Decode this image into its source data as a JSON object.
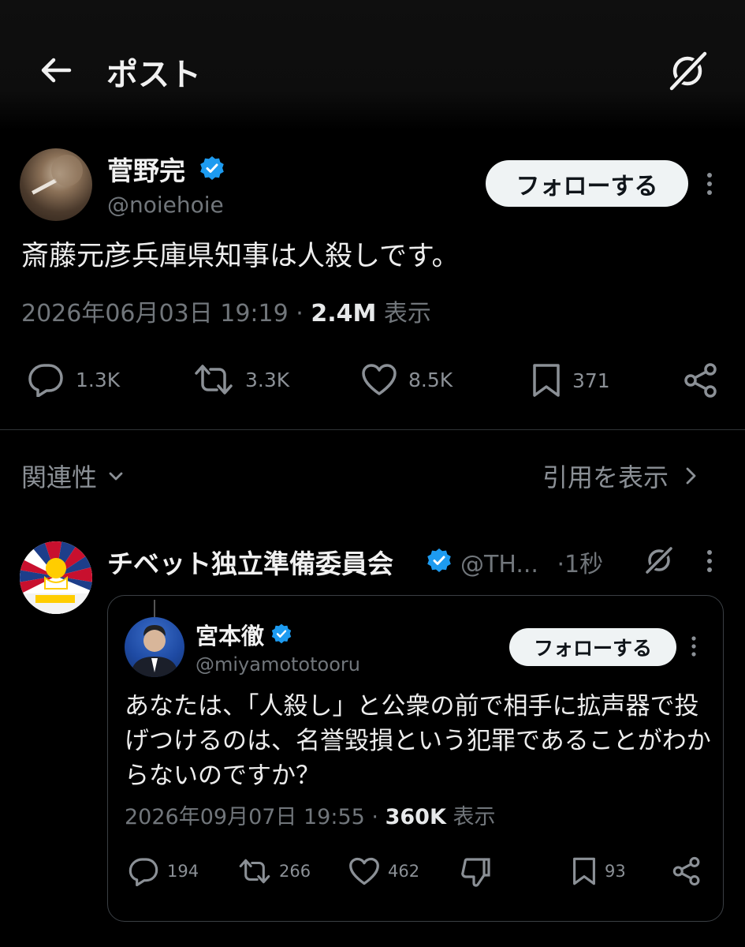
{
  "header": {
    "title": "ポスト"
  },
  "post": {
    "author": "菅野完",
    "handle": "@noiehoie",
    "follow_label": "フォローする",
    "text": "斎藤元彦兵庫県知事は人殺しです。",
    "date": "2026年06月03日 19:19",
    "separator": "·",
    "views": "2.4M",
    "views_label": "表示",
    "replies": "1.3K",
    "reposts": "3.3K",
    "likes": "8.5K",
    "bookmarks": "371"
  },
  "filter": {
    "relevance_label": "関連性",
    "quotes_label": "引用を表示"
  },
  "reply": {
    "author": "チベット独立準備委員会",
    "handle": "@TH...",
    "time": "·1秒",
    "quote": {
      "author": "宮本徹",
      "handle": "@miyamototooru",
      "follow_label": "フォローする",
      "text": "あなたは、「人殺し」と公衆の前で相手に拡声器で投げつけるのは、名誉毀損という犯罪であることがわからないのですか？",
      "date": "2026年09月07日 19:55",
      "separator": "·",
      "views": "360K",
      "views_label": "表示",
      "replies": "194",
      "reposts": "266",
      "likes": "462",
      "bookmarks": "93"
    }
  },
  "colors": {
    "background": "#000000",
    "verified": "#1d9bf0",
    "muted": "#71767b"
  }
}
